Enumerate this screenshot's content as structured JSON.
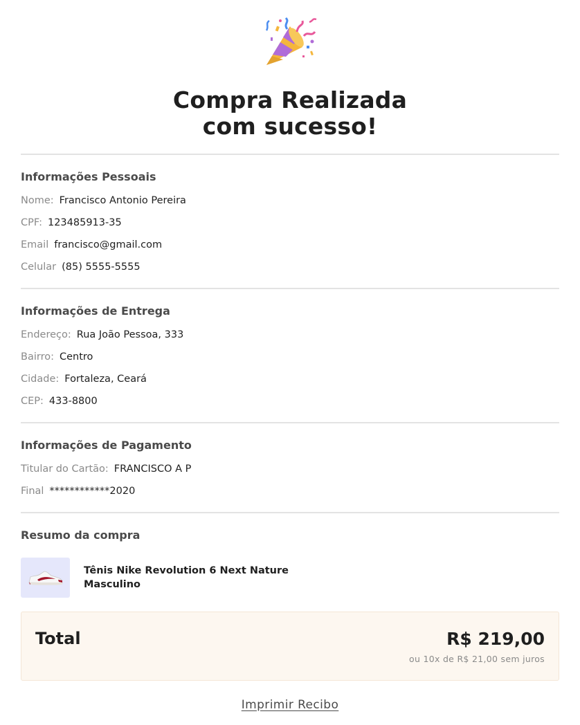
{
  "hero": {
    "icon": "party-popper-icon",
    "title_line1": "Compra Realizada",
    "title_line2": "com sucesso!"
  },
  "personal": {
    "title": "Informações Pessoais",
    "fields": [
      {
        "label": "Nome:",
        "value": "Francisco Antonio Pereira"
      },
      {
        "label": "CPF:",
        "value": "123485913-35"
      },
      {
        "label": "Email",
        "value": "francisco@gmail.com"
      },
      {
        "label": "Celular",
        "value": "(85) 5555-5555"
      }
    ]
  },
  "delivery": {
    "title": "Informações de Entrega",
    "fields": [
      {
        "label": "Endereço:",
        "value": "Rua João Pessoa, 333"
      },
      {
        "label": "Bairro:",
        "value": "Centro"
      },
      {
        "label": "Cidade:",
        "value": "Fortaleza, Ceará"
      },
      {
        "label": "CEP:",
        "value": "433-8800"
      }
    ]
  },
  "payment": {
    "title": "Informações de Pagamento",
    "fields": [
      {
        "label": "Titular do Cartão:",
        "value": "FRANCISCO A P"
      },
      {
        "label": "Final",
        "value": "************2020"
      }
    ]
  },
  "summary": {
    "title": "Resumo da compra",
    "product": {
      "name": "Tênis Nike Revolution 6 Next Nature Masculino",
      "thumb_icon": "sneaker-icon",
      "thumb_bg": "#e5e7fb"
    }
  },
  "total": {
    "label": "Total",
    "value": "R$ 219,00",
    "installments": "ou 10x de R$ 21,00 sem juros"
  },
  "actions": {
    "print_label": "Imprimir Recibo"
  },
  "colors": {
    "total_bg": "#fdf7f0",
    "divider": "#e3e3e3",
    "label_gray": "#8a8a8a"
  }
}
